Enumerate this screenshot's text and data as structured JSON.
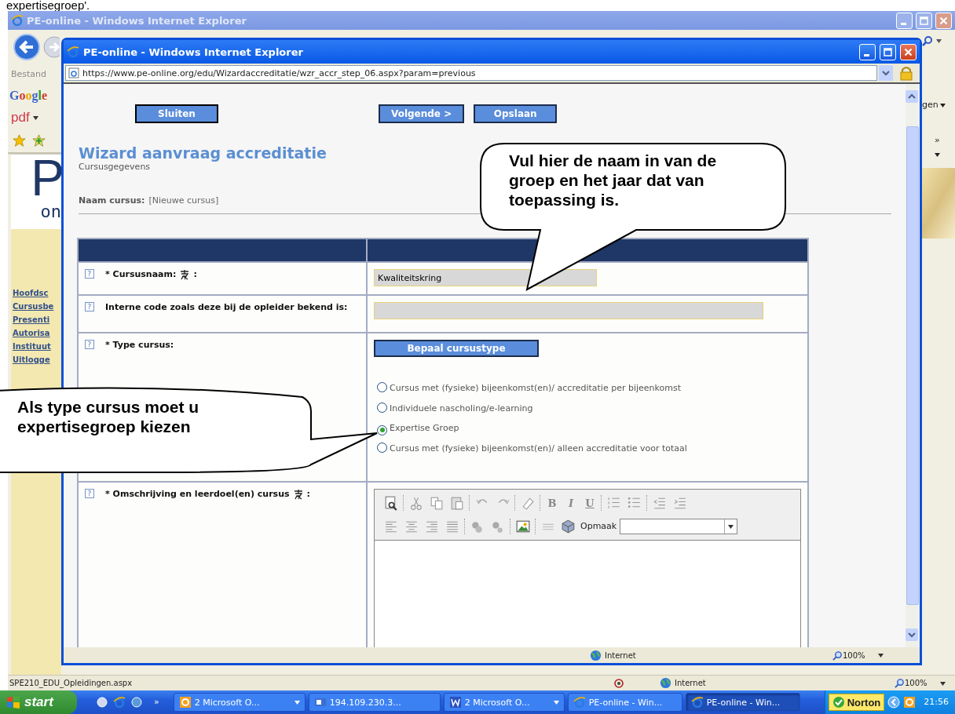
{
  "caption": "expertisegroep'.",
  "outer_window": {
    "title": "PE-online - Windows Internet Explorer",
    "menu": "Bestand",
    "google": "Google",
    "pdf": "pdf",
    "page_menu": "gen",
    "overflow": "»",
    "logo_letter": "P",
    "logo_text": "on",
    "sidebar": [
      {
        "label": "Hoofdsc"
      },
      {
        "label": "Cursusbe"
      },
      {
        "label": "Presenti"
      },
      {
        "label": "Autorisa"
      },
      {
        "label": "Instituut"
      },
      {
        "label": "Uitlogge"
      }
    ],
    "status_bar": {
      "text": "SPE210_EDU_Opleidingen.aspx",
      "zone": "Internet",
      "zoom": "100%"
    }
  },
  "popup": {
    "title": "PE-online - Windows Internet Explorer",
    "address": "https://www.pe-online.org/edu/Wizardaccreditatie/wzr_accr_step_06.aspx?param=previous",
    "buttons": [
      {
        "label": "Sluiten"
      },
      {
        "label": "Volgende >"
      },
      {
        "label": "Opslaan"
      }
    ],
    "heading": "Wizard aanvraag accreditatie",
    "subheading": "Cursusgegevens",
    "course_label": "Naam cursus:",
    "course_value": "[Nieuwe cursus]",
    "form": {
      "rows": [
        {
          "kind": "text",
          "help": "?",
          "label": "* Cursusnaam:",
          "translatable": true,
          "suffix": ":",
          "value": "Kwaliteitskring",
          "long": false
        },
        {
          "kind": "text",
          "help": "?",
          "label": "Interne code zoals deze bij de opleider bekend is:",
          "translatable": false,
          "long": true
        },
        {
          "kind": "choice",
          "help": "?",
          "label": "* Type cursus:",
          "translatable": false,
          "button": "Bepaal cursustype",
          "options": [
            {
              "label": "Cursus met (fysieke) bijeenkomst(en)/ accreditatie per bijeenkomst",
              "selected": false
            },
            {
              "label": "Individuele nascholing/e-learning",
              "selected": false
            },
            {
              "label": "Expertise Groep",
              "selected": true
            },
            {
              "label": "Cursus met (fysieke) bijeenkomst(en)/ alleen accreditatie voor totaal",
              "selected": false
            }
          ]
        },
        {
          "kind": "editor",
          "help": "?",
          "label": "* Omschrijving en leerdoel(en) cursus",
          "translatable": true,
          "suffix": ":",
          "bold": "B",
          "italic": "I",
          "underline": "U",
          "format_label": "Opmaak"
        }
      ]
    },
    "status_bar": {
      "zone": "Internet",
      "zoom": "100%"
    }
  },
  "callouts": [
    {
      "text": "Vul hier de naam in van de groep en het jaar dat van toepassing is."
    },
    {
      "text": "Als type cursus moet u expertisegroep kiezen"
    }
  ],
  "taskbar": {
    "start": "start",
    "overflow": "»",
    "buttons": [
      {
        "label": "2 Microsoft O...",
        "kind": "group",
        "selected": false
      },
      {
        "label": "194.109.230.3...",
        "kind": "single",
        "selected": false
      },
      {
        "label": "2 Microsoft O...",
        "kind": "group",
        "selected": false
      },
      {
        "label": "PE-online - Win...",
        "kind": "single",
        "selected": false
      },
      {
        "label": "PE-online - Win...",
        "kind": "single",
        "selected": true
      }
    ],
    "norton": "Norton",
    "clock": "21:56"
  }
}
